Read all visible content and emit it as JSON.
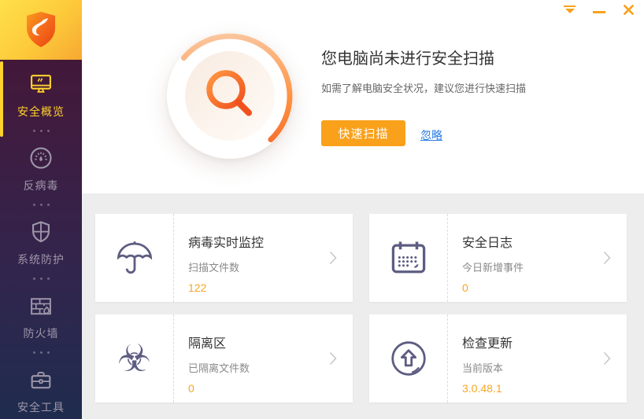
{
  "titlebar": {
    "controls": [
      {
        "name": "menu"
      },
      {
        "name": "minimize"
      },
      {
        "name": "close"
      }
    ]
  },
  "sidebar": {
    "logo": "shield-logo",
    "items": [
      {
        "label": "安全概览",
        "icon": "monitor-icon",
        "active": true
      },
      {
        "label": "反病毒",
        "icon": "gauge-icon",
        "active": false
      },
      {
        "label": "系统防护",
        "icon": "shield-cross-icon",
        "active": false
      },
      {
        "label": "防火墙",
        "icon": "firewall-icon",
        "active": false
      },
      {
        "label": "安全工具",
        "icon": "toolbox-icon",
        "active": false
      }
    ]
  },
  "hero": {
    "title": "您电脑尚未进行安全扫描",
    "subtitle": "如需了解电脑安全状况，建议您进行快速扫描",
    "scan_button": "快速扫描",
    "ignore_link": "忽略",
    "center_icon": "magnifier-icon"
  },
  "cards": [
    {
      "title": "病毒实时监控",
      "subtitle": "扫描文件数",
      "value": "122",
      "icon": "umbrella-icon"
    },
    {
      "title": "安全日志",
      "subtitle": "今日新增事件",
      "value": "0",
      "icon": "calendar-icon"
    },
    {
      "title": "隔离区",
      "subtitle": "已隔离文件数",
      "value": "0",
      "icon": "biohazard-icon",
      "glyph": "☣"
    },
    {
      "title": "检查更新",
      "subtitle": "当前版本",
      "value": "3.0.48.1",
      "icon": "update-icon"
    }
  ],
  "colors": {
    "accent_orange": "#f9a11b",
    "value_orange": "#f7a723",
    "link_blue": "#2a7de1",
    "active_yellow": "#ffd22c",
    "sidebar_top": "#451432",
    "sidebar_bottom": "#1f2c4e",
    "page_gray": "#ededee"
  }
}
